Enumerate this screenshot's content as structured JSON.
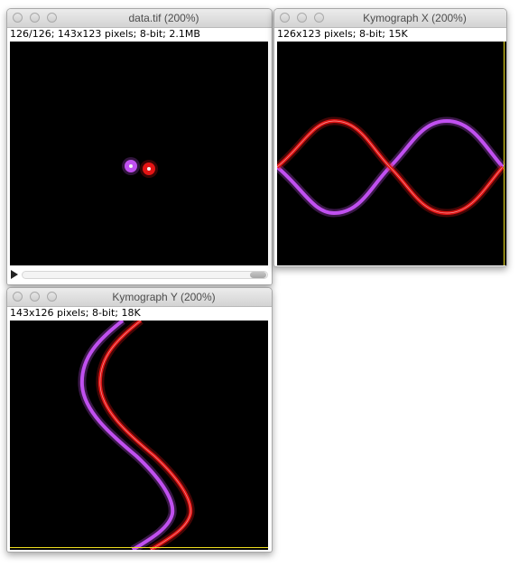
{
  "windows": {
    "data": {
      "title": "data.tif (200%)",
      "info": "126/126; 143x123 pixels; 8-bit; 2.1MB"
    },
    "kymo_x": {
      "title": "Kymograph X (200%)",
      "info": "126x123 pixels; 8-bit; 15K"
    },
    "kymo_y": {
      "title": "Kymograph Y (200%)",
      "info": "143x126 pixels; 8-bit; 18K"
    }
  },
  "colors": {
    "purple": "#c050f0",
    "red": "#e41414",
    "highlight": "#f2f2f2",
    "background": "#000000",
    "edge_line": "#f0e020"
  },
  "icons": {
    "close": "circle",
    "minimize": "circle",
    "zoom": "circle",
    "play": "triangle-right"
  }
}
